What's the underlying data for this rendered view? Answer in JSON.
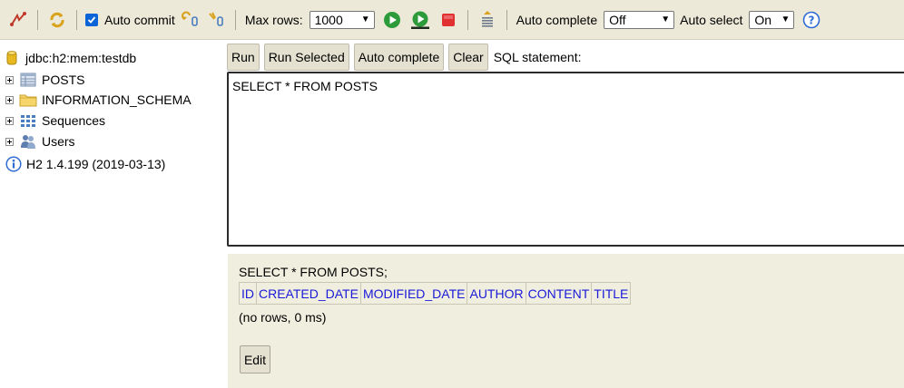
{
  "toolbar": {
    "auto_commit_label": "Auto commit",
    "max_rows_label": "Max rows:",
    "max_rows_value": "1000",
    "auto_complete_label": "Auto complete",
    "auto_complete_value": "Off",
    "auto_select_label": "Auto select",
    "auto_select_value": "On",
    "help_label": "?"
  },
  "tree": {
    "connection": "jdbc:h2:mem:testdb",
    "items": [
      {
        "label": "POSTS",
        "icon": "table-icon"
      },
      {
        "label": "INFORMATION_SCHEMA",
        "icon": "folder-icon"
      },
      {
        "label": "Sequences",
        "icon": "sequences-icon"
      },
      {
        "label": "Users",
        "icon": "users-icon"
      }
    ],
    "version": "H2 1.4.199 (2019-03-13)"
  },
  "editor": {
    "buttons": [
      "Run",
      "Run Selected",
      "Auto complete",
      "Clear"
    ],
    "sql_label": "SQL statement:",
    "sql_text": "SELECT * FROM POSTS"
  },
  "result": {
    "statement": "SELECT * FROM POSTS;",
    "columns": [
      "ID",
      "CREATED_DATE",
      "MODIFIED_DATE",
      "AUTHOR",
      "CONTENT",
      "TITLE"
    ],
    "message": "(no rows, 0 ms)",
    "edit_label": "Edit"
  },
  "colors": {
    "toolbar_bg": "#ece9d8",
    "result_bg": "#f0eedf",
    "link_blue": "#1a1ad8",
    "run_green": "#2e9b3a",
    "stop_red": "#e03030"
  }
}
